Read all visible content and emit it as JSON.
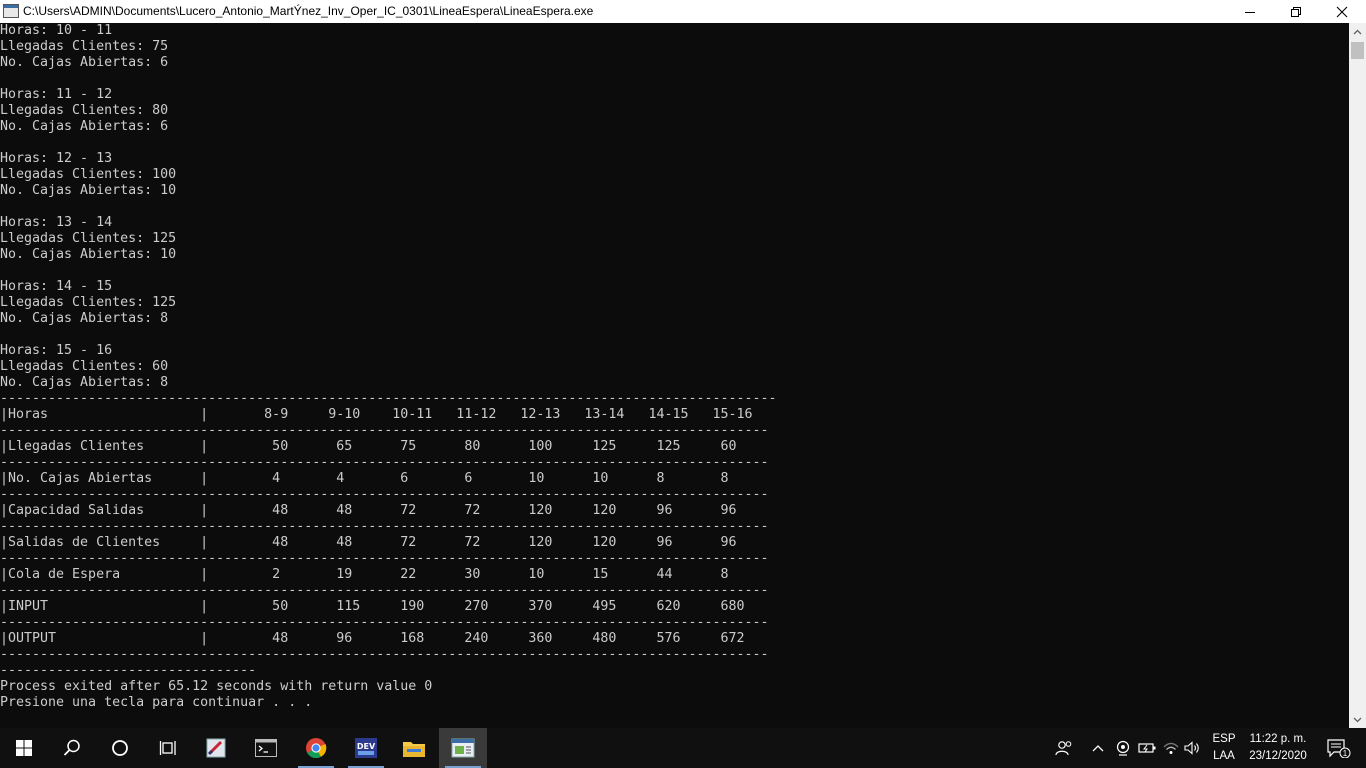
{
  "window": {
    "title": "C:\\Users\\ADMIN\\Documents\\Lucero_Antonio_MartÝnez_Inv_Oper_IC_0301\\LineaEspera\\LineaEspera.exe"
  },
  "console": {
    "lines": [
      "Horas: 10 - 11",
      "Llegadas Clientes: 75",
      "No. Cajas Abiertas: 6",
      "",
      "Horas: 11 - 12",
      "Llegadas Clientes: 80",
      "No. Cajas Abiertas: 6",
      "",
      "Horas: 12 - 13",
      "Llegadas Clientes: 100",
      "No. Cajas Abiertas: 10",
      "",
      "Horas: 13 - 14",
      "Llegadas Clientes: 125",
      "No. Cajas Abiertas: 10",
      "",
      "Horas: 14 - 15",
      "Llegadas Clientes: 125",
      "No. Cajas Abiertas: 8",
      "",
      "Horas: 15 - 16",
      "Llegadas Clientes: 60",
      "No. Cajas Abiertas: 8",
      "-------------------------------------------------------------------------------------------------",
      "|Horas                   |       8-9     9-10    10-11   11-12   12-13   13-14   14-15   15-16",
      "------------------------------------------------------------------------------------------------",
      "|Llegadas Clientes       |        50      65      75      80      100     125     125     60",
      "------------------------------------------------------------------------------------------------",
      "|No. Cajas Abiertas      |        4       4       6       6       10      10      8       8",
      "------------------------------------------------------------------------------------------------",
      "|Capacidad Salidas       |        48      48      72      72      120     120     96      96",
      "------------------------------------------------------------------------------------------------",
      "|Salidas de Clientes     |        48      48      72      72      120     120     96      96",
      "------------------------------------------------------------------------------------------------",
      "|Cola de Espera          |        2       19      22      30      10      15      44      8",
      "------------------------------------------------------------------------------------------------",
      "|INPUT                   |        50      115     190     270     370     495     620     680",
      "------------------------------------------------------------------------------------------------",
      "|OUTPUT                  |        48      96      168     240     360     480     576     672",
      "------------------------------------------------------------------------------------------------",
      "--------------------------------",
      "Process exited after 65.12 seconds with return value 0",
      "Presione una tecla para continuar . . ."
    ]
  },
  "taskbar": {
    "apps": [
      {
        "name": "chrome-icon",
        "running": true
      },
      {
        "name": "dev-cpp-icon",
        "running": true
      },
      {
        "name": "file-explorer-icon",
        "running": false
      },
      {
        "name": "console-window-icon",
        "running": true,
        "active": true
      }
    ],
    "language": {
      "line1": "ESP",
      "line2": "LAA"
    },
    "clock": {
      "time": "11:22 p. m.",
      "date": "23/12/2020"
    },
    "notifications_count": "1"
  },
  "colors": {
    "console_bg": "#0c0c0c",
    "console_text": "#cccccc",
    "taskbar_bg": "#101010",
    "titlebar_bg": "#ffffff"
  }
}
